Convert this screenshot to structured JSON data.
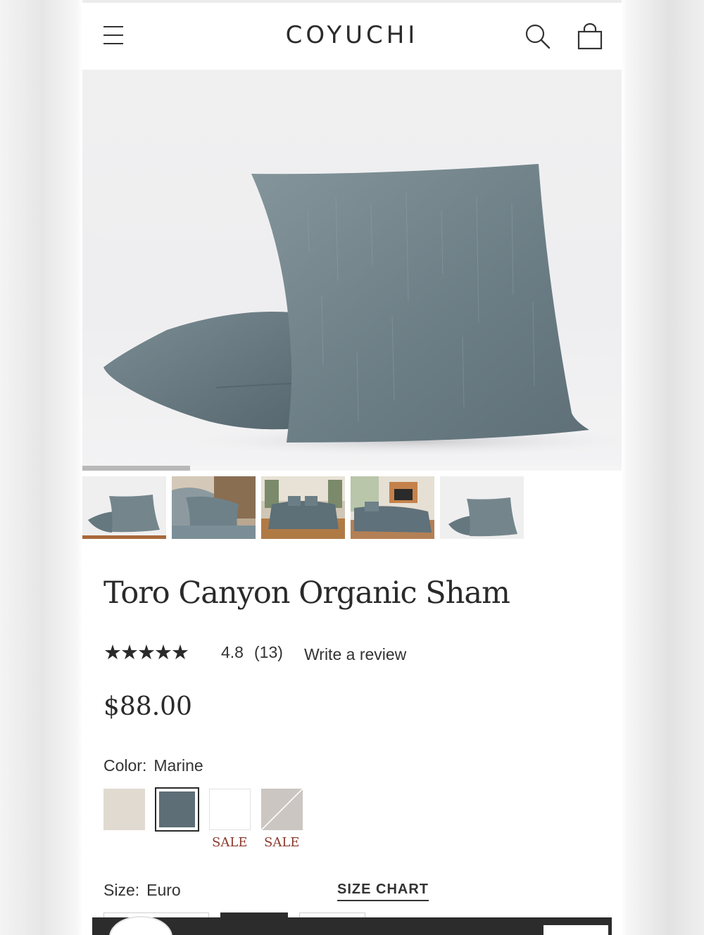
{
  "brand": {
    "logo_text": "COYUCHI"
  },
  "header": {
    "menu_icon": "hamburger-menu-icon",
    "search_icon": "search-icon",
    "cart_icon": "shopping-bag-icon"
  },
  "gallery": {
    "thumbnail_count": 5,
    "active_index": 0,
    "scroll_progress": 0.2
  },
  "product": {
    "title": "Toro Canyon Organic Sham",
    "rating_stars": "★★★★★",
    "rating_value": "4.8",
    "rating_count": "(13)",
    "write_review": "Write a review",
    "price": "$88.00"
  },
  "color": {
    "label": "Color:",
    "selected": "Marine",
    "swatches": [
      {
        "hex": "#e1dad0",
        "sale": ""
      },
      {
        "hex": "#5d6e77",
        "sale": ""
      },
      {
        "hex": "#ffffff",
        "sale": "SALE"
      },
      {
        "hex": "#cbc6c1",
        "sale": "SALE"
      }
    ]
  },
  "size": {
    "label": "Size:",
    "selected": "Euro",
    "size_chart": "SIZE CHART"
  },
  "colors": {
    "text": "#2a2a2a",
    "sale": "#8a3a2e",
    "accent": "#a8683a",
    "pillow": "#6d7f86"
  }
}
